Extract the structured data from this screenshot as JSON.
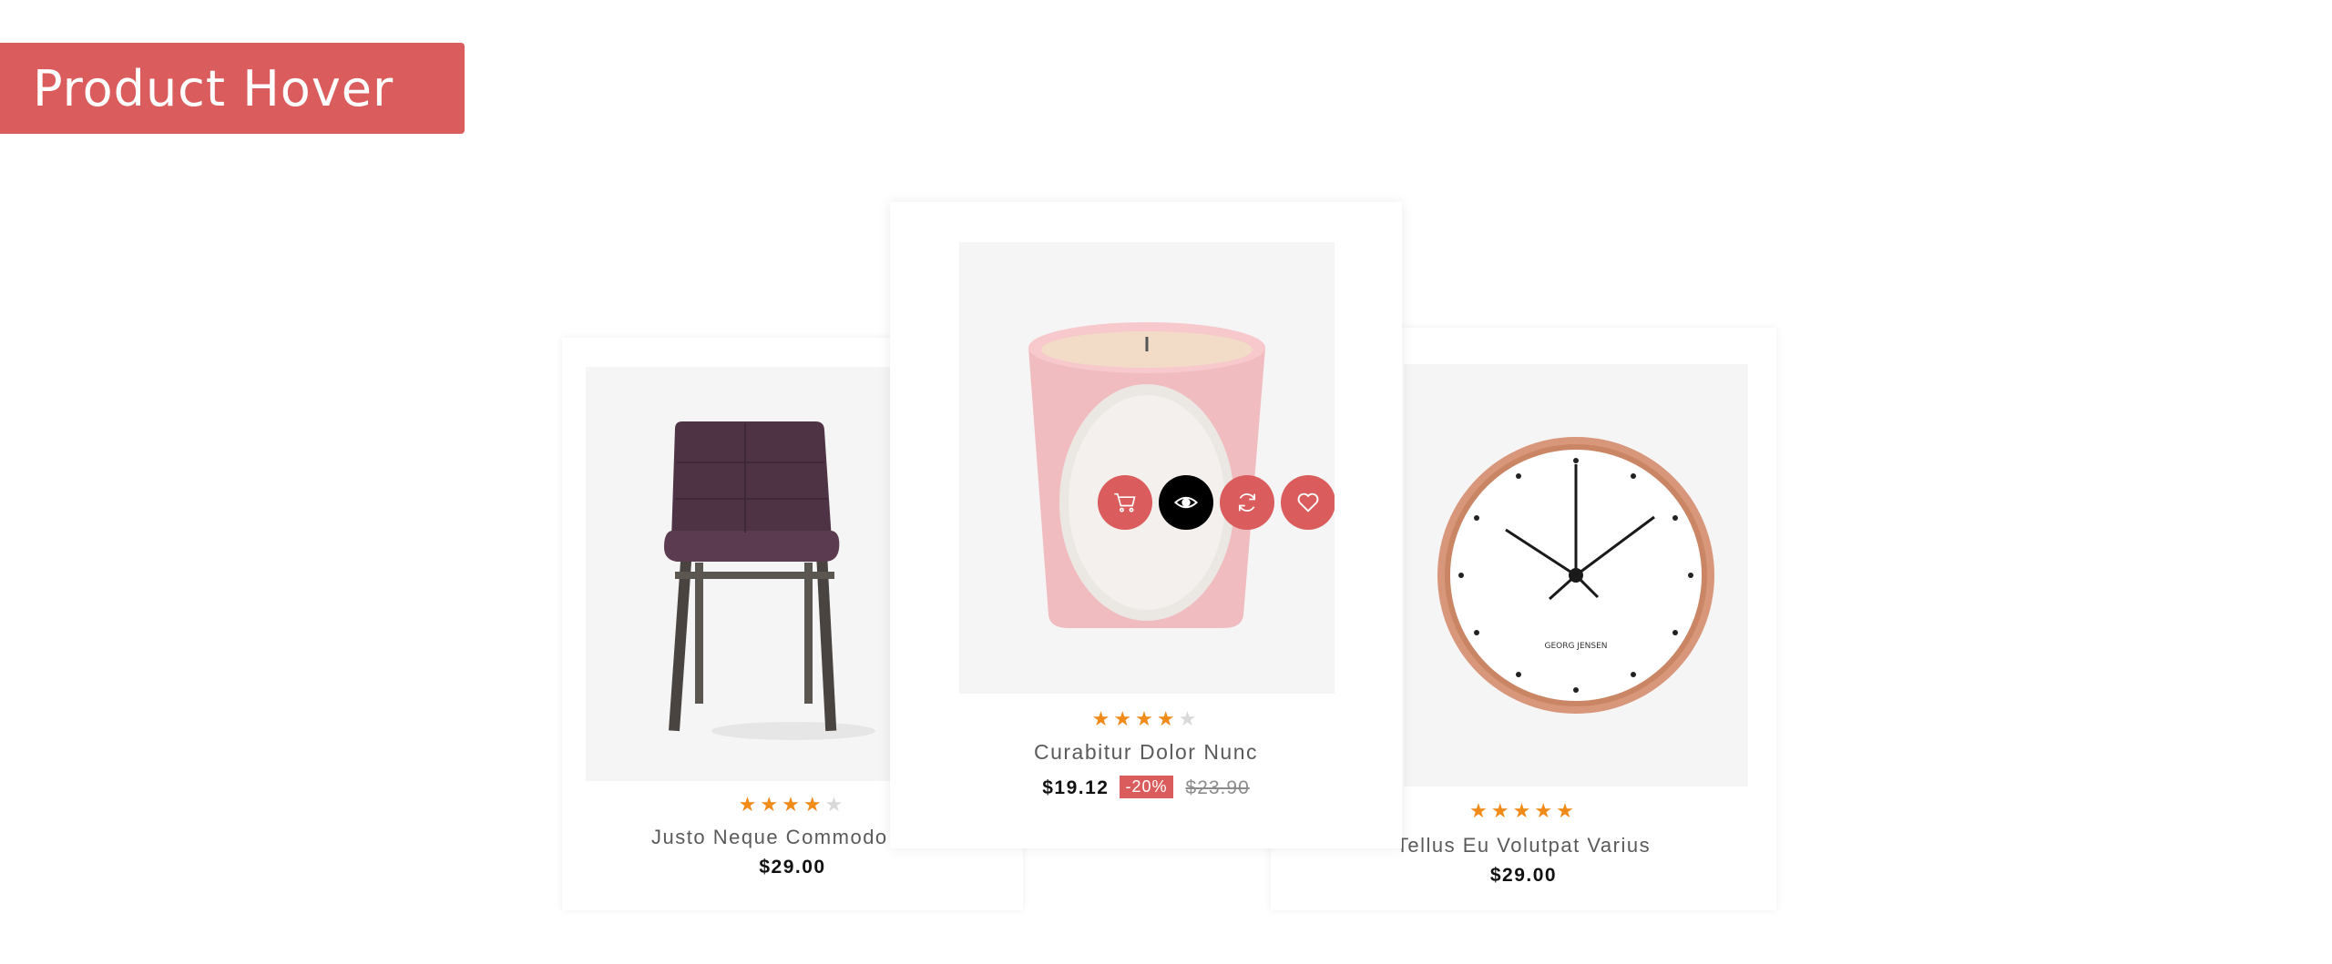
{
  "page": {
    "banner_title": "Product Hover"
  },
  "colors": {
    "accent": "#db5c5c",
    "star": "#f08a18",
    "star_empty": "#d9d9d9"
  },
  "products": [
    {
      "name": "Justo Neque Commodo Nisl",
      "price": "$29.00",
      "rating": 4,
      "rating_max": 5,
      "image": "purple-upholstered-chair"
    },
    {
      "name": "Curabitur Dolor Nunc",
      "price": "$19.12",
      "discount": "-20%",
      "old_price": "$23.90",
      "rating": 4,
      "rating_max": 5,
      "image": "pink-scented-candle",
      "hover_actions": [
        {
          "icon": "cart-icon"
        },
        {
          "icon": "eye-icon"
        },
        {
          "icon": "compare-icon"
        },
        {
          "icon": "heart-icon"
        }
      ]
    },
    {
      "name": "Tellus Eu Volutpat Varius",
      "price": "$29.00",
      "rating": 5,
      "rating_max": 5,
      "image": "copper-wall-clock",
      "image_text": "GEORG JENSEN"
    }
  ]
}
